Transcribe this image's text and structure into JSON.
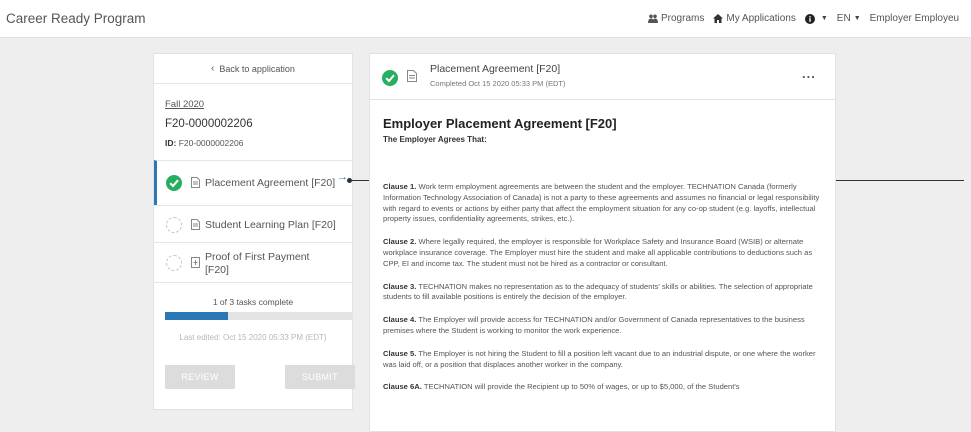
{
  "header": {
    "brand": "Career Ready Program",
    "nav": {
      "programs": "Programs",
      "my_applications": "My Applications",
      "language": "EN",
      "user": "Employer Employeu"
    }
  },
  "sidebar": {
    "back_label": "Back to application",
    "term": "Fall 2020",
    "application_number": "F20-0000002206",
    "id_label": "ID:",
    "id_value": "F20-0000002206",
    "tasks": [
      {
        "label": "Placement Agreement [F20]",
        "status": "complete"
      },
      {
        "label": "Student Learning Plan [F20]",
        "status": "pending"
      },
      {
        "label": "Proof of First Payment [F20]",
        "status": "pending"
      }
    ],
    "progress_text": "1 of 3 tasks complete",
    "progress_fraction": 0.333,
    "last_edited": "Last edited: Oct 15 2020 05:33 PM (EDT)",
    "review_label": "REVIEW",
    "submit_label": "SUBMIT"
  },
  "document": {
    "header_title": "Placement Agreement [F20]",
    "header_subtitle": "Completed Oct 15 2020 05:33 PM (EDT)",
    "more_label": "...",
    "title": "Employer Placement Agreement [F20]",
    "subtitle": "The Employer Agrees That:",
    "clauses": [
      {
        "label": "Clause 1.",
        "text": "Work term employment agreements are between the student and the employer. TECHNATION Canada (formerly Information Technology Association of Canada) is not a party to these agreements and assumes no financial or legal responsibility with regard to events or actions by either party that affect the employment situation for any co-op student (e.g. layoffs, intellectual property issues, confidentiality agreements, strikes, etc.)."
      },
      {
        "label": "Clause 2.",
        "text": "Where legally required, the employer is responsible for Workplace Safety and Insurance Board (WSIB) or alternate workplace insurance coverage. The Employer must hire the student and make all applicable contributions to deductions such as CPP, EI and income tax. The student must not be hired as a contractor or consultant."
      },
      {
        "label": "Clause 3.",
        "text": "TECHNATION makes no representation as to the adequacy of students' skills or abilities. The selection of appropriate students to fill available positions is entirely the decision of the employer."
      },
      {
        "label": "Clause 4.",
        "text": "The Employer will provide access for TECHNATION and/or Government of Canada representatives to the business premises where the Student is working to monitor the work experience."
      },
      {
        "label": "Clause 5.",
        "text": "The Employer is not hiring the Student to fill a position left vacant due to an industrial dispute, or one where the worker was laid off, or a position that displaces another worker in the company."
      },
      {
        "label": "Clause 6A.",
        "text": "TECHNATION will provide the Recipient up to 50% of wages, or up to $5,000, of the Student's"
      }
    ]
  },
  "colors": {
    "accent": "#2a78b5",
    "success": "#27ae60",
    "disabled_button": "#dcdcdc"
  }
}
